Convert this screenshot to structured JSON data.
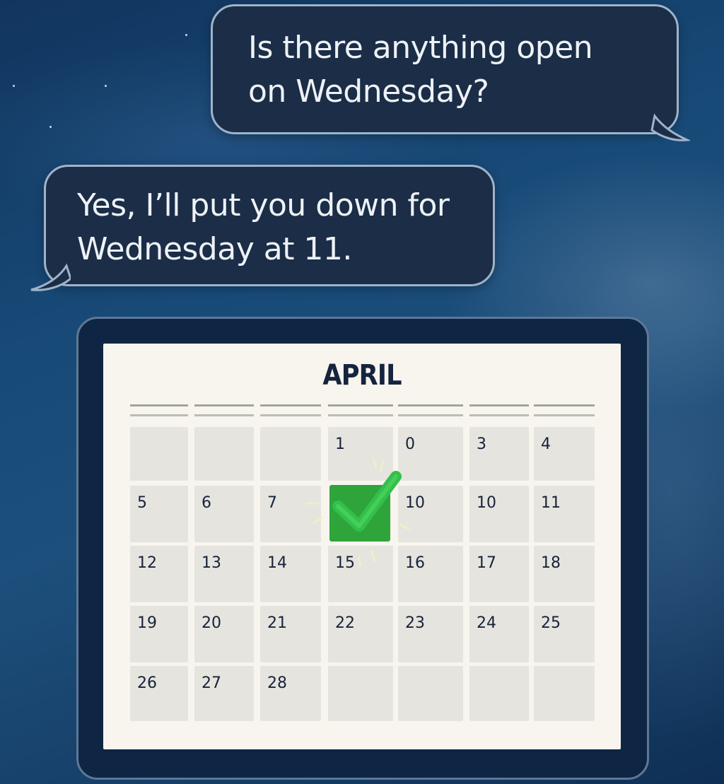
{
  "chat": {
    "user_message_line1": "Is there anything open",
    "user_message_line2": "on Wednesday?",
    "reply_message_line1": "Yes, I’ll put you down for",
    "reply_message_line2": "Wednesday at 11."
  },
  "calendar": {
    "month": "APRIL",
    "rows": [
      [
        "",
        "",
        "",
        "1",
        "0",
        "3",
        "4"
      ],
      [
        "5",
        "6",
        "7",
        "",
        "10",
        "10",
        "11"
      ],
      [
        "12",
        "13",
        "14",
        "15",
        "16",
        "17",
        "18"
      ],
      [
        "19",
        "20",
        "21",
        "22",
        "23",
        "24",
        "25"
      ],
      [
        "26",
        "27",
        "28",
        "",
        "",
        "",
        ""
      ]
    ],
    "checked_day_position": "row 2, column 4",
    "check_color": "#2fa43b"
  },
  "icons": {
    "check": "checkmark-icon"
  }
}
